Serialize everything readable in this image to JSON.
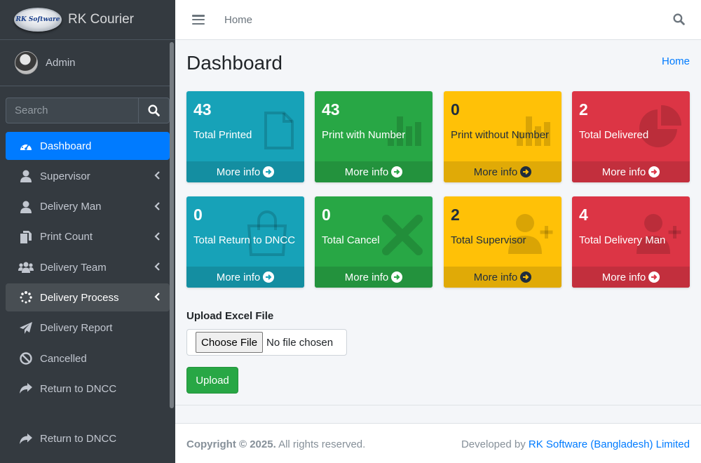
{
  "brand": {
    "logo_text": "RK Software",
    "name": "RK Courier"
  },
  "user": {
    "name": "Admin"
  },
  "search": {
    "placeholder": "Search"
  },
  "sidebar": {
    "items": [
      {
        "label": "Dashboard",
        "icon": "tachometer-icon"
      },
      {
        "label": "Supervisor",
        "icon": "user-icon"
      },
      {
        "label": "Delivery Man",
        "icon": "user-icon"
      },
      {
        "label": "Print Count",
        "icon": "copy-icon"
      },
      {
        "label": "Delivery Team",
        "icon": "users-icon"
      },
      {
        "label": "Delivery Process",
        "icon": "spinner-icon"
      },
      {
        "label": "Delivery Report",
        "icon": "paper-plane-icon"
      },
      {
        "label": "Cancelled",
        "icon": "ban-icon"
      },
      {
        "label": "Return to DNCC",
        "icon": "share-icon"
      },
      {
        "label": "Return to DNCC",
        "icon": "share-icon"
      }
    ]
  },
  "header": {
    "home": "Home"
  },
  "page": {
    "title": "Dashboard",
    "breadcrumb": "Home"
  },
  "boxes": [
    {
      "value": "43",
      "label": "Total Printed",
      "more": "More info",
      "color": "#17a2b8"
    },
    {
      "value": "43",
      "label": "Print with Number",
      "more": "More info",
      "color": "#28a745"
    },
    {
      "value": "0",
      "label": "Print without Number",
      "more": "More info",
      "color": "#ffc107"
    },
    {
      "value": "2",
      "label": "Total Delivered",
      "more": "More info",
      "color": "#dc3545"
    },
    {
      "value": "0",
      "label": "Total Return to DNCC",
      "more": "More info",
      "color": "#17a2b8"
    },
    {
      "value": "0",
      "label": "Total Cancel",
      "more": "More info",
      "color": "#28a745"
    },
    {
      "value": "2",
      "label": "Total Supervisor",
      "more": "More info",
      "color": "#ffc107"
    },
    {
      "value": "4",
      "label": "Total Delivery Man",
      "more": "More info",
      "color": "#dc3545"
    }
  ],
  "upload": {
    "label": "Upload Excel File",
    "choose": "Choose File",
    "none": "No file chosen",
    "button": "Upload"
  },
  "footer": {
    "copyright": "Copyright © 2025.",
    "rights": "All rights reserved.",
    "developed": "Developed by",
    "company": "RK Software (Bangladesh) Limited"
  }
}
